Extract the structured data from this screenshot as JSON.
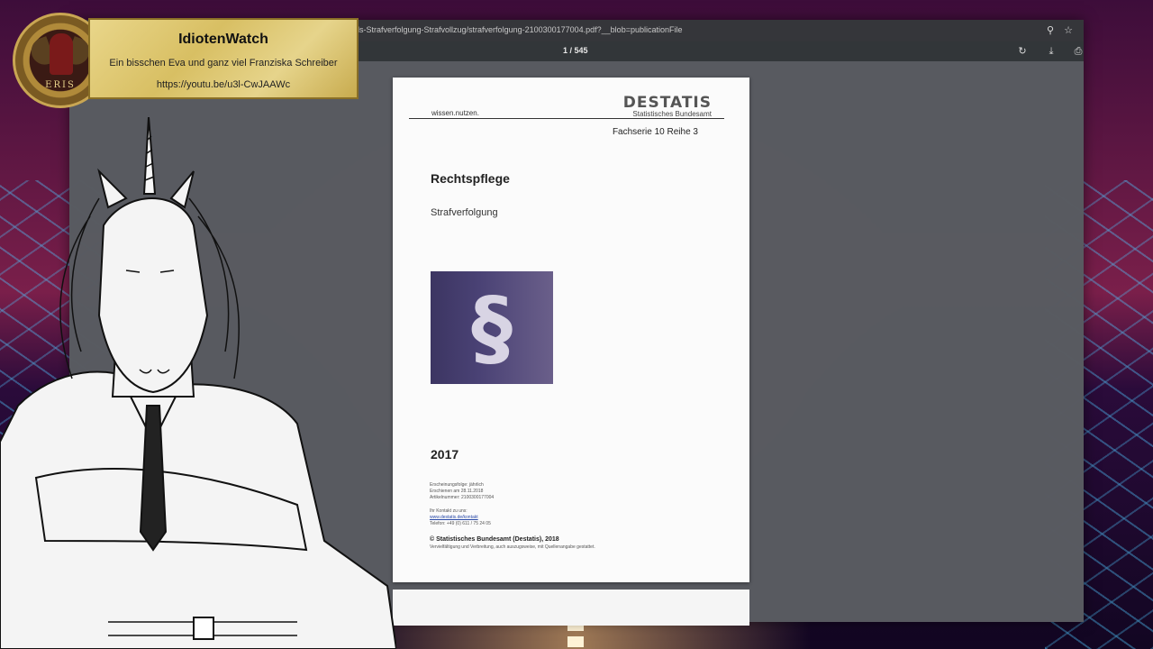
{
  "browser": {
    "url": "ls-Strafverfolgung-Strafvollzug/strafverfolgung-2100300177004.pdf?__blob=publicationFile",
    "page_indicator": "1 / 545"
  },
  "pdf_page": {
    "logo": "DESTATIS",
    "logo_sub": "Statistisches Bundesamt",
    "slogan": "wissen.nutzen.",
    "series": "Fachserie 10 Reihe 3",
    "title": "Rechtspflege",
    "subtitle": "Strafverfolgung",
    "symbol": "§",
    "year": "2017",
    "meta_line1": "Erscheinungsfolge: jährlich",
    "meta_line2": "Erschienen am 28.11.2018",
    "meta_line3": "Artikelnummer: 2100300177004",
    "contact_line1": "Ihr Kontakt zu uns:",
    "contact_link": "www.destatis.de/kontakt",
    "contact_phone": "Telefon: +49 (0) 611 / 75 24 05",
    "copyright": "© Statistisches Bundesamt (Destatis), 2018",
    "rights": "Vervielfältigung und Verbreitung, auch auszugsweise, mit Quellenangabe gestattet."
  },
  "overlay": {
    "title": "IdiotenWatch",
    "subtitle": "Ein bisschen Eva und ganz viel Franziska Schreiber",
    "link": "https://youtu.be/u3l-CwJAAWc",
    "seal_text": "ERIS"
  },
  "icons": {
    "zoom": "search-icon",
    "bookmark": "star-icon",
    "rotate": "rotate-icon",
    "download": "download-icon",
    "print": "print-icon"
  }
}
